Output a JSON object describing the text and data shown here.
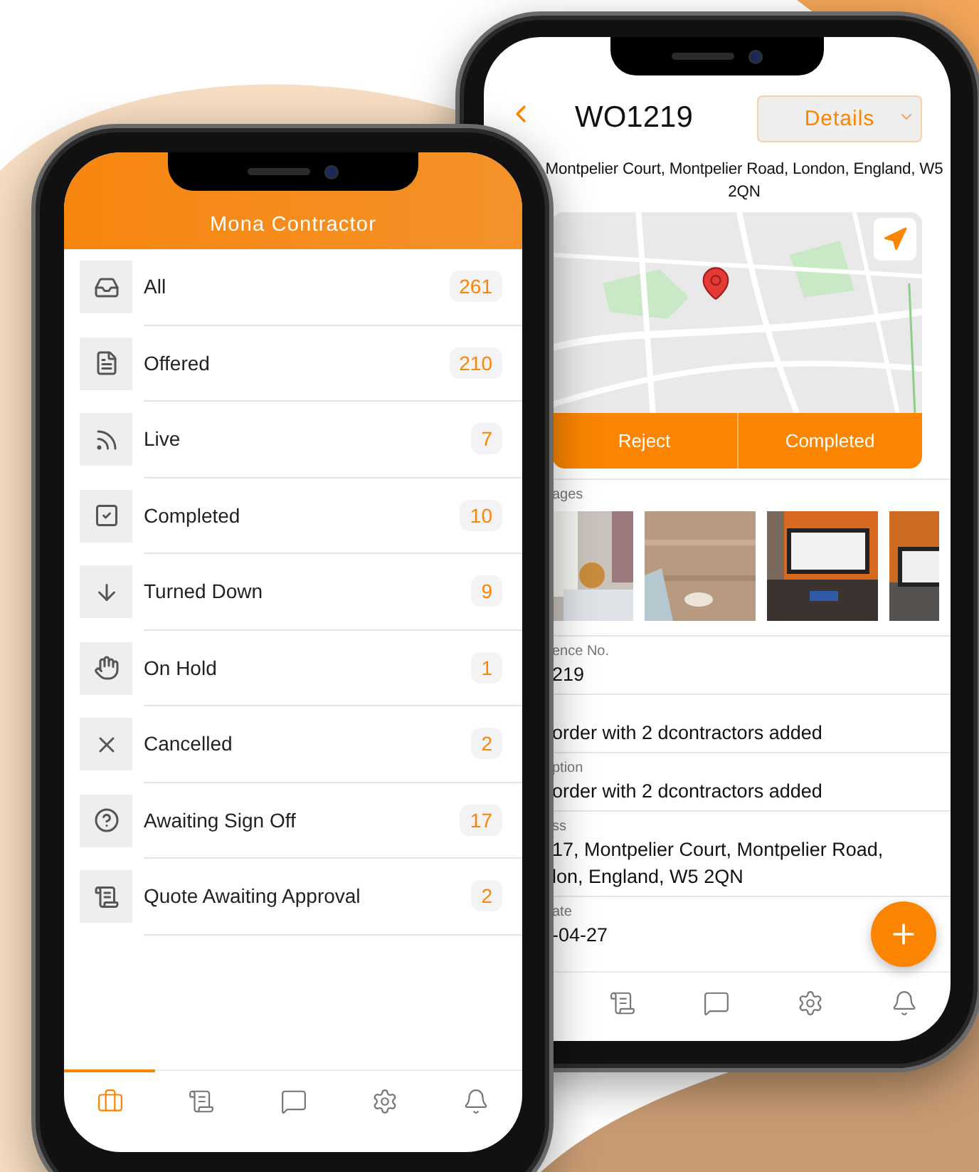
{
  "list_phone": {
    "title": "Mona Contractor",
    "items": [
      {
        "label": "All",
        "count": "261"
      },
      {
        "label": "Offered",
        "count": "210"
      },
      {
        "label": "Live",
        "count": "7"
      },
      {
        "label": "Completed",
        "count": "10"
      },
      {
        "label": "Turned Down",
        "count": "9"
      },
      {
        "label": "On Hold",
        "count": "1"
      },
      {
        "label": "Cancelled",
        "count": "2"
      },
      {
        "label": "Awaiting Sign Off",
        "count": "17"
      },
      {
        "label": "Quote Awaiting Approval",
        "count": "2"
      }
    ],
    "tabs": [
      {
        "selected": true
      },
      {
        "selected": false
      },
      {
        "selected": false
      },
      {
        "selected": false
      },
      {
        "selected": false
      }
    ]
  },
  "detail_phone": {
    "title": "WO1219",
    "dropdown": "Details",
    "address": "Montpelier Court, Montpelier Road, London, England, W5 2QN",
    "map": {
      "kind": "picture"
    },
    "actions": [
      "Reject",
      "Completed"
    ],
    "images_label": "ages",
    "images": [
      {
        "kind": "picture"
      },
      {
        "kind": "picture"
      },
      {
        "kind": "picture"
      },
      {
        "kind": "picture"
      }
    ],
    "fields": [
      {
        "label": "ence No.",
        "lines": [
          "219"
        ]
      },
      {
        "lines": [
          "order with 2 dcontractors added"
        ]
      },
      {
        "label": "ption",
        "lines": [
          "order with 2 dcontractors added"
        ]
      },
      {
        "label": "ss",
        "lines": [
          "17, Montpelier Court, Montpelier Road,",
          "lon, England, W5 2QN"
        ]
      },
      {
        "label": "ate",
        "lines": [
          "-04-27"
        ]
      }
    ],
    "tabs": [
      {
        "selected": false
      },
      {
        "selected": false
      },
      {
        "selected": false
      },
      {
        "selected": false
      }
    ]
  }
}
